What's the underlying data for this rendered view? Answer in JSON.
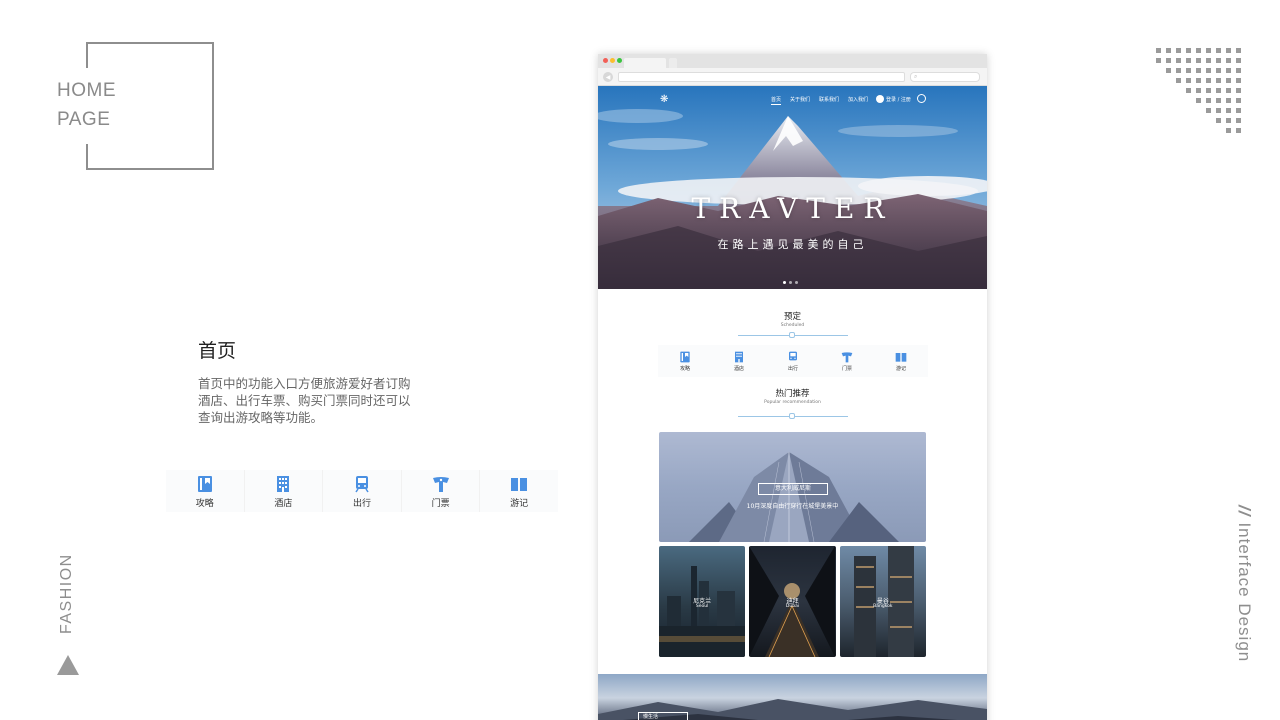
{
  "left_panel": {
    "home_title_line1": "HOME",
    "home_title_line2": "PAGE",
    "section_title": "首页",
    "section_desc": "首页中的功能入口方便旅游爱好者订购酒店、出行车票、购买门票同时还可以查询出游攻略等功能。",
    "icons": [
      {
        "label": "攻略",
        "icon": "guide-icon"
      },
      {
        "label": "酒店",
        "icon": "hotel-icon"
      },
      {
        "label": "出行",
        "icon": "train-icon"
      },
      {
        "label": "门票",
        "icon": "ticket-icon"
      },
      {
        "label": "游记",
        "icon": "travel-notes-icon"
      }
    ],
    "fashion": "FASHION"
  },
  "right_panel": {
    "interface_prefix": "//",
    "interface_text": "Interface Design"
  },
  "browser": {
    "nav": {
      "items": [
        "首页",
        "关于我们",
        "联系我们",
        "加入我们"
      ],
      "user": "登录 / 注册"
    },
    "hero": {
      "title": "TRAVTER",
      "subtitle": "在路上遇见最美的自己"
    },
    "scheduled": {
      "title": "预定",
      "subtitle": "Scheduled"
    },
    "icons": [
      {
        "label": "攻略",
        "icon": "guide-icon"
      },
      {
        "label": "酒店",
        "icon": "hotel-icon"
      },
      {
        "label": "出行",
        "icon": "train-icon"
      },
      {
        "label": "门票",
        "icon": "ticket-icon"
      },
      {
        "label": "游记",
        "icon": "travel-notes-icon"
      }
    ],
    "popular": {
      "title": "热门推荐",
      "subtitle": "Popular recommendation"
    },
    "feature": {
      "button": "意大利威尼斯",
      "subtitle": "10月深度自由行穿行在城堡美景中"
    },
    "cards": [
      {
        "name": "尼克兰",
        "en": "Seoul"
      },
      {
        "name": "迪拜",
        "en": "Dubai"
      },
      {
        "name": "曼谷",
        "en": "Bangkok"
      }
    ],
    "bottom_button": "慢生活"
  },
  "colors": {
    "accent": "#4a90e2",
    "gray": "#8e8e8e"
  }
}
